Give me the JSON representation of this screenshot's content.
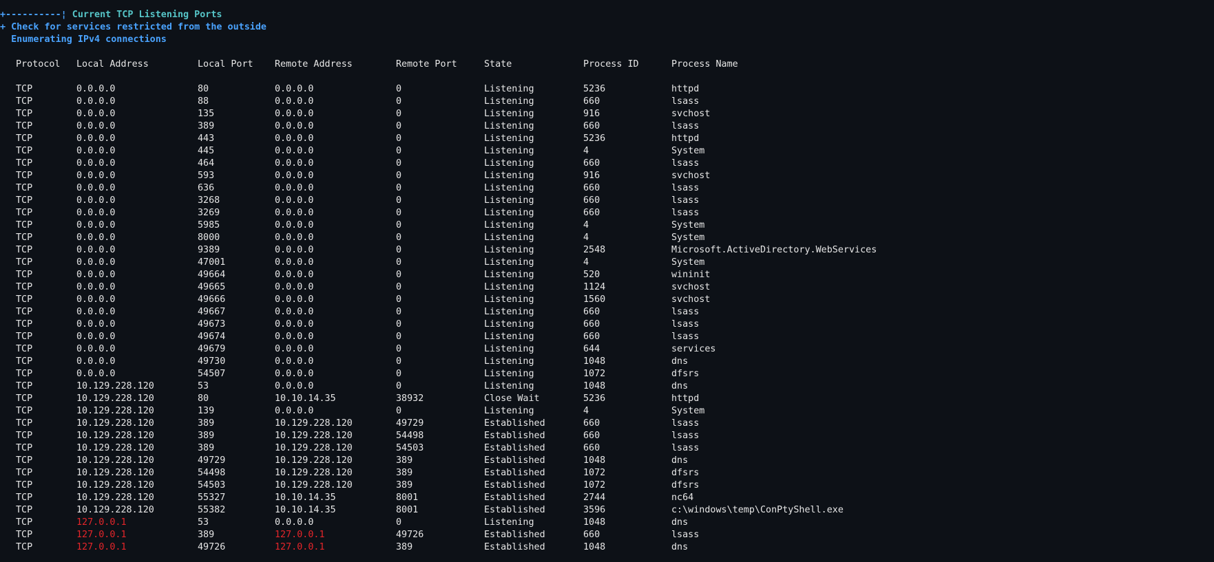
{
  "header": {
    "prefix": "+----------¦",
    "title": " Current TCP Listening Ports",
    "check_line": "+ Check for services restricted from the outside",
    "enum_line": "  Enumerating IPv4 connections"
  },
  "colors": {
    "background": "#0d1117",
    "text": "#e6e6e6",
    "title_cyan": "#56c5c8",
    "info_blue": "#4aa3ff",
    "highlight_red": "#e5252a"
  },
  "table": {
    "columns": [
      "Protocol",
      "Local Address",
      "Local Port",
      "Remote Address",
      "Remote Port",
      "State",
      "Process ID",
      "Process Name"
    ],
    "rows": [
      [
        "TCP",
        "0.0.0.0",
        "80",
        "0.0.0.0",
        "0",
        "Listening",
        "5236",
        "httpd"
      ],
      [
        "TCP",
        "0.0.0.0",
        "88",
        "0.0.0.0",
        "0",
        "Listening",
        "660",
        "lsass"
      ],
      [
        "TCP",
        "0.0.0.0",
        "135",
        "0.0.0.0",
        "0",
        "Listening",
        "916",
        "svchost"
      ],
      [
        "TCP",
        "0.0.0.0",
        "389",
        "0.0.0.0",
        "0",
        "Listening",
        "660",
        "lsass"
      ],
      [
        "TCP",
        "0.0.0.0",
        "443",
        "0.0.0.0",
        "0",
        "Listening",
        "5236",
        "httpd"
      ],
      [
        "TCP",
        "0.0.0.0",
        "445",
        "0.0.0.0",
        "0",
        "Listening",
        "4",
        "System"
      ],
      [
        "TCP",
        "0.0.0.0",
        "464",
        "0.0.0.0",
        "0",
        "Listening",
        "660",
        "lsass"
      ],
      [
        "TCP",
        "0.0.0.0",
        "593",
        "0.0.0.0",
        "0",
        "Listening",
        "916",
        "svchost"
      ],
      [
        "TCP",
        "0.0.0.0",
        "636",
        "0.0.0.0",
        "0",
        "Listening",
        "660",
        "lsass"
      ],
      [
        "TCP",
        "0.0.0.0",
        "3268",
        "0.0.0.0",
        "0",
        "Listening",
        "660",
        "lsass"
      ],
      [
        "TCP",
        "0.0.0.0",
        "3269",
        "0.0.0.0",
        "0",
        "Listening",
        "660",
        "lsass"
      ],
      [
        "TCP",
        "0.0.0.0",
        "5985",
        "0.0.0.0",
        "0",
        "Listening",
        "4",
        "System"
      ],
      [
        "TCP",
        "0.0.0.0",
        "8000",
        "0.0.0.0",
        "0",
        "Listening",
        "4",
        "System"
      ],
      [
        "TCP",
        "0.0.0.0",
        "9389",
        "0.0.0.0",
        "0",
        "Listening",
        "2548",
        "Microsoft.ActiveDirectory.WebServices"
      ],
      [
        "TCP",
        "0.0.0.0",
        "47001",
        "0.0.0.0",
        "0",
        "Listening",
        "4",
        "System"
      ],
      [
        "TCP",
        "0.0.0.0",
        "49664",
        "0.0.0.0",
        "0",
        "Listening",
        "520",
        "wininit"
      ],
      [
        "TCP",
        "0.0.0.0",
        "49665",
        "0.0.0.0",
        "0",
        "Listening",
        "1124",
        "svchost"
      ],
      [
        "TCP",
        "0.0.0.0",
        "49666",
        "0.0.0.0",
        "0",
        "Listening",
        "1560",
        "svchost"
      ],
      [
        "TCP",
        "0.0.0.0",
        "49667",
        "0.0.0.0",
        "0",
        "Listening",
        "660",
        "lsass"
      ],
      [
        "TCP",
        "0.0.0.0",
        "49673",
        "0.0.0.0",
        "0",
        "Listening",
        "660",
        "lsass"
      ],
      [
        "TCP",
        "0.0.0.0",
        "49674",
        "0.0.0.0",
        "0",
        "Listening",
        "660",
        "lsass"
      ],
      [
        "TCP",
        "0.0.0.0",
        "49679",
        "0.0.0.0",
        "0",
        "Listening",
        "644",
        "services"
      ],
      [
        "TCP",
        "0.0.0.0",
        "49730",
        "0.0.0.0",
        "0",
        "Listening",
        "1048",
        "dns"
      ],
      [
        "TCP",
        "0.0.0.0",
        "54507",
        "0.0.0.0",
        "0",
        "Listening",
        "1072",
        "dfsrs"
      ],
      [
        "TCP",
        "10.129.228.120",
        "53",
        "0.0.0.0",
        "0",
        "Listening",
        "1048",
        "dns"
      ],
      [
        "TCP",
        "10.129.228.120",
        "80",
        "10.10.14.35",
        "38932",
        "Close Wait",
        "5236",
        "httpd"
      ],
      [
        "TCP",
        "10.129.228.120",
        "139",
        "0.0.0.0",
        "0",
        "Listening",
        "4",
        "System"
      ],
      [
        "TCP",
        "10.129.228.120",
        "389",
        "10.129.228.120",
        "49729",
        "Established",
        "660",
        "lsass"
      ],
      [
        "TCP",
        "10.129.228.120",
        "389",
        "10.129.228.120",
        "54498",
        "Established",
        "660",
        "lsass"
      ],
      [
        "TCP",
        "10.129.228.120",
        "389",
        "10.129.228.120",
        "54503",
        "Established",
        "660",
        "lsass"
      ],
      [
        "TCP",
        "10.129.228.120",
        "49729",
        "10.129.228.120",
        "389",
        "Established",
        "1048",
        "dns"
      ],
      [
        "TCP",
        "10.129.228.120",
        "54498",
        "10.129.228.120",
        "389",
        "Established",
        "1072",
        "dfsrs"
      ],
      [
        "TCP",
        "10.129.228.120",
        "54503",
        "10.129.228.120",
        "389",
        "Established",
        "1072",
        "dfsrs"
      ],
      [
        "TCP",
        "10.129.228.120",
        "55327",
        "10.10.14.35",
        "8001",
        "Established",
        "2744",
        "nc64"
      ],
      [
        "TCP",
        "10.129.228.120",
        "55382",
        "10.10.14.35",
        "8001",
        "Established",
        "3596",
        "c:\\windows\\temp\\ConPtyShell.exe"
      ],
      [
        "TCP",
        "127.0.0.1",
        "53",
        "0.0.0.0",
        "0",
        "Listening",
        "1048",
        "dns"
      ],
      [
        "TCP",
        "127.0.0.1",
        "389",
        "127.0.0.1",
        "49726",
        "Established",
        "660",
        "lsass"
      ],
      [
        "TCP",
        "127.0.0.1",
        "49726",
        "127.0.0.1",
        "389",
        "Established",
        "1048",
        "dns"
      ]
    ],
    "highlight_value": "127.0.0.1"
  }
}
